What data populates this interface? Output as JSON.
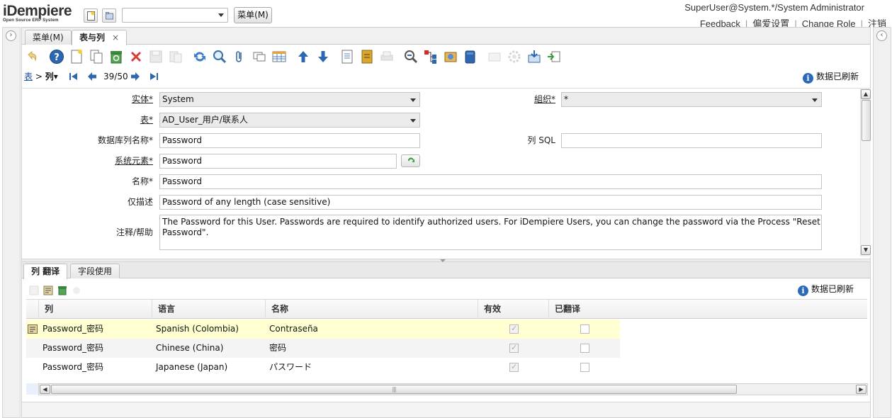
{
  "app": {
    "logo_main": "iDempiere",
    "logo_sub": "Open Source ERP System",
    "menu_button": "菜单(M)",
    "user_info": "SuperUser@System.*/System Administrator",
    "links": [
      "Feedback",
      "偏爱设置",
      "Change Role",
      "注销"
    ]
  },
  "tabs": [
    {
      "label": "菜单(M)",
      "active": false
    },
    {
      "label": "表与列",
      "active": true,
      "close": "×"
    }
  ],
  "toolbar_icons": [
    "undo-icon",
    "help-icon",
    "new-record-icon",
    "copy-record-icon",
    "delete-icon",
    "delete-selection-icon",
    "save-icon",
    "save-and-create-icon",
    "refresh-icon",
    "find-icon",
    "attachment-icon",
    "chat-icon",
    "grid-toggle-icon",
    "previous-record-icon",
    "next-record-icon",
    "report-icon",
    "archive-icon",
    "print-icon",
    "zoom-across-icon",
    "active-workflows-icon",
    "requests-icon",
    "product-info-icon",
    "process-icon",
    "export-icon",
    "import-icon"
  ],
  "breadcrumb": {
    "parent": "表",
    "sep": ">",
    "current": "列▾"
  },
  "record_nav": {
    "position": "39/50"
  },
  "status": "数据已刷新",
  "form": {
    "client": {
      "label": "实体*",
      "value": "System"
    },
    "org": {
      "label": "組织*",
      "value": "*"
    },
    "table": {
      "label": "表*",
      "value": "AD_User_用户/联系人"
    },
    "db_column": {
      "label": "数据库列名称*",
      "value": "Password"
    },
    "column_sql": {
      "label": "列 SQL",
      "value": ""
    },
    "system_element": {
      "label": "系统元素*",
      "value": "Password"
    },
    "name": {
      "label": "名称*",
      "value": "Password"
    },
    "description": {
      "label": "仅描述",
      "value": "Password of any length (case sensitive)"
    },
    "help": {
      "label": "注释/帮助",
      "value": "The Password for this User.  Passwords are required to identify authorized users.  For iDempiere Users, you can change the password via the Process \"Reset Password\"."
    }
  },
  "detail": {
    "tabs": [
      {
        "label": "列 翻译",
        "active": true
      },
      {
        "label": "字段使用",
        "active": false
      }
    ],
    "status": "数据已刷新",
    "columns": [
      "列",
      "语言",
      "名称",
      "有效",
      "已翻译"
    ],
    "rows": [
      {
        "column": "Password_密码",
        "language": "Spanish (Colombia)",
        "name": "Contraseña",
        "active": true,
        "translated": false
      },
      {
        "column": "Password_密码",
        "language": "Chinese (China)",
        "name": "密码",
        "active": true,
        "translated": false
      },
      {
        "column": "Password_密码",
        "language": "Japanese (Japan)",
        "name": "パスワード",
        "active": true,
        "translated": false
      }
    ]
  },
  "colors": {
    "accent": "#1a4f9c",
    "selected_row": "#ffffd2",
    "info": "#2a6ab8"
  }
}
